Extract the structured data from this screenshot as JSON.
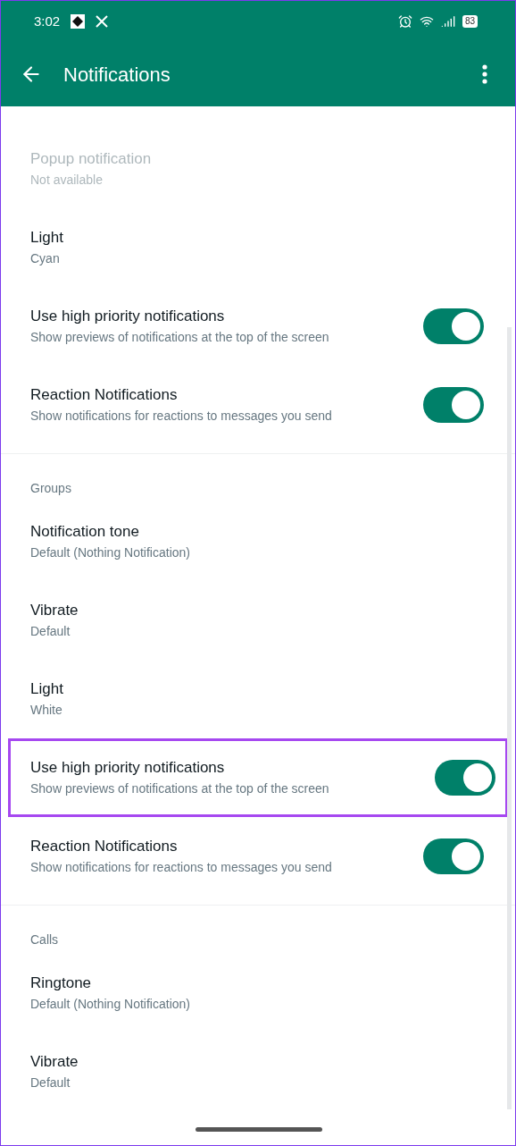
{
  "status_bar": {
    "time": "3:02",
    "battery": "83"
  },
  "toolbar": {
    "title": "Notifications"
  },
  "sections": [
    {
      "items": [
        {
          "kind": "text",
          "title": "Popup notification",
          "subtitle": "Not available",
          "disabled": true,
          "highlighted": false
        },
        {
          "kind": "text",
          "title": "Light",
          "subtitle": "Cyan",
          "disabled": false,
          "highlighted": false
        },
        {
          "kind": "toggle",
          "title": "Use high priority notifications",
          "subtitle": "Show previews of notifications at the top of the screen",
          "on": true,
          "disabled": false,
          "highlighted": false
        },
        {
          "kind": "toggle",
          "title": "Reaction Notifications",
          "subtitle": "Show notifications for reactions to messages you send",
          "on": true,
          "disabled": false,
          "highlighted": false
        }
      ]
    },
    {
      "header": "Groups",
      "items": [
        {
          "kind": "text",
          "title": "Notification tone",
          "subtitle": "Default (Nothing Notification)",
          "disabled": false,
          "highlighted": false
        },
        {
          "kind": "text",
          "title": "Vibrate",
          "subtitle": "Default",
          "disabled": false,
          "highlighted": false
        },
        {
          "kind": "text",
          "title": "Light",
          "subtitle": "White",
          "disabled": false,
          "highlighted": false
        },
        {
          "kind": "toggle",
          "title": "Use high priority notifications",
          "subtitle": "Show previews of notifications at the top of the screen",
          "on": true,
          "disabled": false,
          "highlighted": true
        },
        {
          "kind": "toggle",
          "title": "Reaction Notifications",
          "subtitle": "Show notifications for reactions to messages you send",
          "on": true,
          "disabled": false,
          "highlighted": false
        }
      ]
    },
    {
      "header": "Calls",
      "items": [
        {
          "kind": "text",
          "title": "Ringtone",
          "subtitle": "Default (Nothing Notification)",
          "disabled": false,
          "highlighted": false
        },
        {
          "kind": "text",
          "title": "Vibrate",
          "subtitle": "Default",
          "disabled": false,
          "highlighted": false
        }
      ]
    }
  ]
}
